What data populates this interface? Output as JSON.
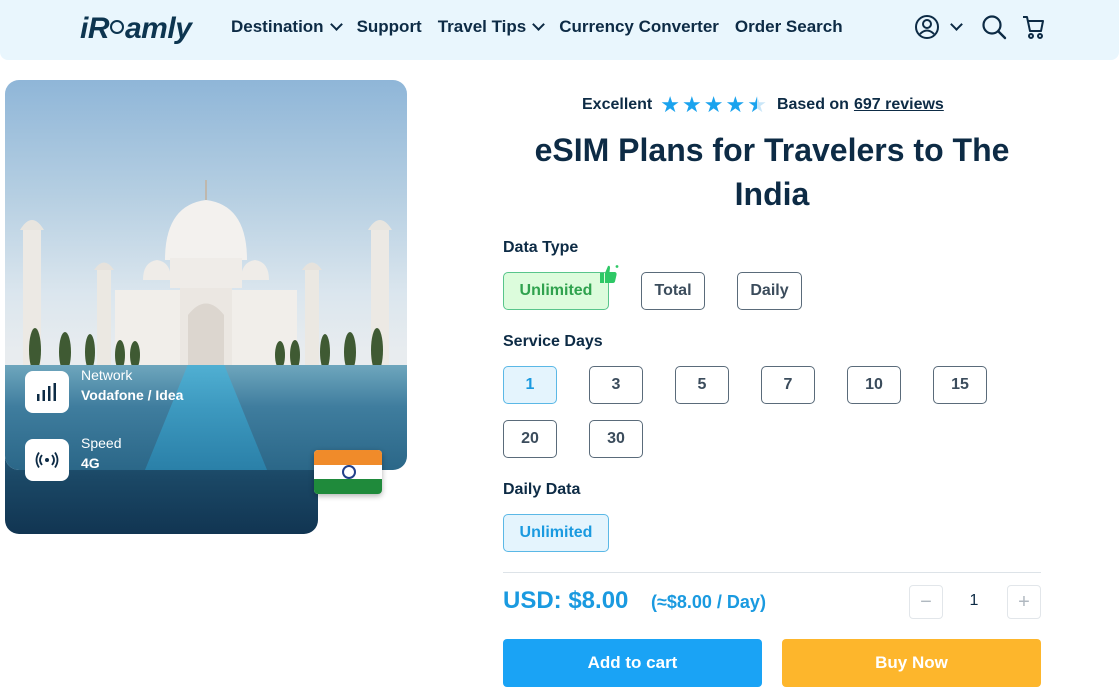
{
  "header": {
    "logo": "iRoamly",
    "nav": [
      "Destination",
      "Support",
      "Travel Tips",
      "Currency Converter",
      "Order Search"
    ],
    "nav_has_dropdown": [
      true,
      false,
      true,
      false,
      false
    ]
  },
  "hero": {
    "network_label": "Network",
    "network_value": "Vodafone / Idea",
    "speed_label": "Speed",
    "speed_value": "4G"
  },
  "rating": {
    "label": "Excellent",
    "stars": 4.5,
    "based_on": "Based on",
    "reviews": "697 reviews"
  },
  "title": "eSIM Plans for Travelers to The India",
  "data_type": {
    "label": "Data Type",
    "options": [
      "Unlimited",
      "Total",
      "Daily"
    ],
    "selected": "Unlimited"
  },
  "service_days": {
    "label": "Service Days",
    "options": [
      "1",
      "3",
      "5",
      "7",
      "10",
      "15",
      "20",
      "30"
    ],
    "selected": "1"
  },
  "daily_data": {
    "label": "Daily Data",
    "options": [
      "Unlimited"
    ],
    "selected": "Unlimited"
  },
  "price": {
    "total": "USD: $8.00",
    "per_day": "(≈$8.00 / Day)"
  },
  "quantity": {
    "minus": "−",
    "value": "1",
    "plus": "+"
  },
  "actions": {
    "add_to_cart": "Add to cart",
    "buy_now": "Buy Now"
  },
  "colors": {
    "accent_blue": "#1aa3f5",
    "buy_orange": "#fdb62c",
    "header_bg": "#e9f6fd",
    "text_dark": "#0d2b45"
  }
}
